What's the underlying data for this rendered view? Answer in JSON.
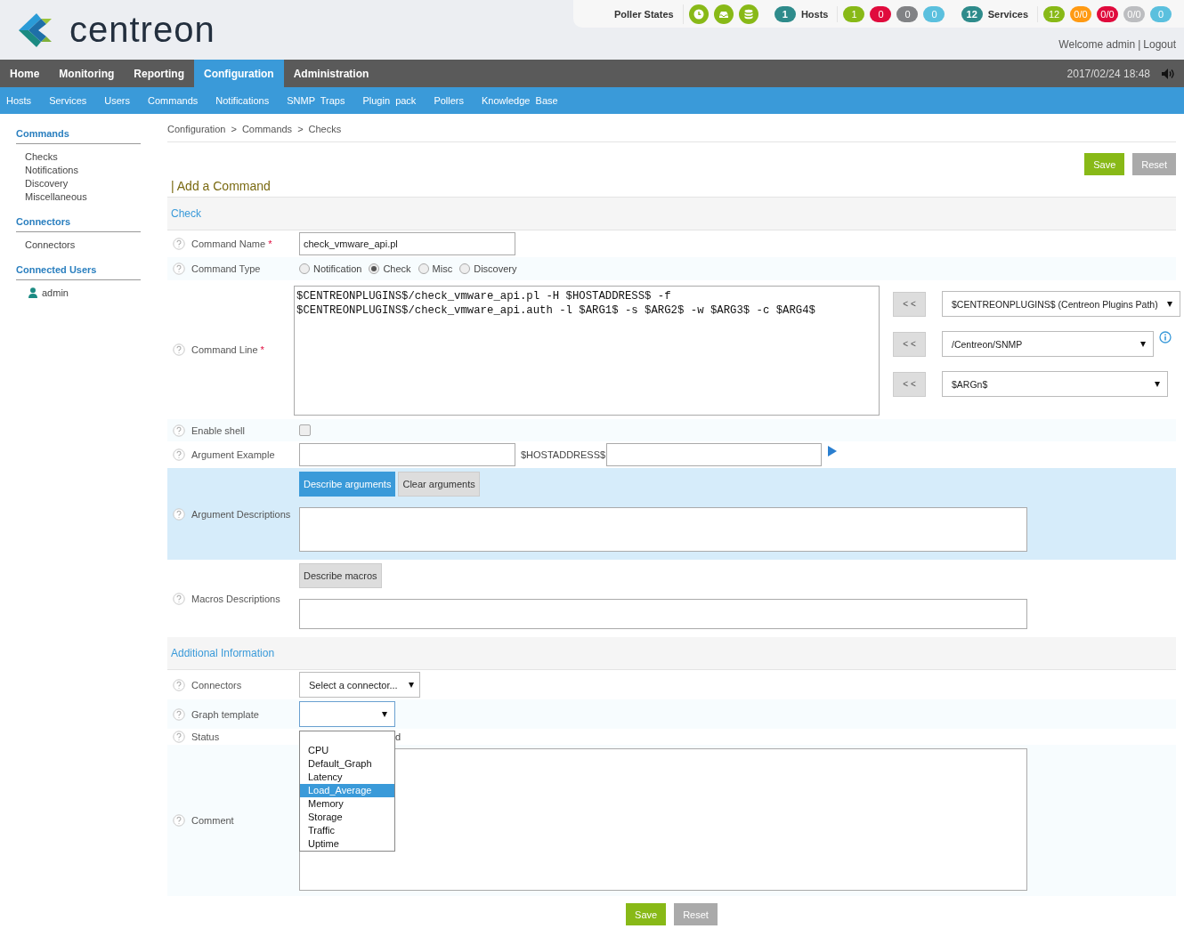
{
  "header": {
    "logo_text": "centreon",
    "poller_states": {
      "label": "Poller States"
    },
    "hosts": {
      "count": "1",
      "label": "Hosts",
      "badges": [
        {
          "text": "1",
          "color": "#88b917"
        },
        {
          "text": "0",
          "color": "#e00b3d"
        },
        {
          "text": "0",
          "color": "#818285"
        },
        {
          "text": "0",
          "color": "#5bc0de"
        }
      ]
    },
    "services": {
      "count": "12",
      "label": "Services",
      "badges": [
        {
          "text": "12",
          "color": "#88b917"
        },
        {
          "text": "0/0",
          "color": "#ff9a13"
        },
        {
          "text": "0/0",
          "color": "#e00b3d"
        },
        {
          "text": "0/0",
          "color": "#bcbdc0"
        },
        {
          "text": "0",
          "color": "#5bc0de"
        }
      ]
    },
    "welcome": "Welcome admin",
    "separator": "|",
    "logout": "Logout"
  },
  "menu": [
    {
      "label": "Home",
      "selected": false
    },
    {
      "label": "Monitoring",
      "selected": false
    },
    {
      "label": "Reporting",
      "selected": false
    },
    {
      "label": "Configuration",
      "selected": true
    },
    {
      "label": "Administration",
      "selected": false
    }
  ],
  "datetime": "2017/02/24 18:48",
  "submenu": [
    "Hosts",
    "Services",
    "Users",
    "Commands",
    "Notifications",
    "SNMP  Traps",
    "Plugin  pack",
    "Pollers",
    "Knowledge  Base"
  ],
  "sidebar": [
    {
      "title": "Commands",
      "kind": "links",
      "items": [
        "Checks",
        "Notifications",
        "Discovery",
        "Miscellaneous"
      ]
    },
    {
      "title": "Connectors",
      "kind": "links",
      "items": [
        "Connectors"
      ]
    },
    {
      "title": "Connected Users",
      "kind": "users",
      "items": [
        "admin"
      ]
    }
  ],
  "breadcrumb": {
    "items": [
      "Configuration",
      "Commands",
      "Checks"
    ],
    "separator": ">"
  },
  "top_buttons": [
    "Save",
    "Reset"
  ],
  "title": "| Add a Command",
  "sections": [
    {
      "title": "Check",
      "rows": [
        {
          "kind": "text",
          "label": "Command Name",
          "required_mark": "*",
          "value": "check_vmware_api.pl"
        },
        {
          "kind": "radio",
          "label": "Command Type",
          "options": [
            {
              "label": "Notification",
              "selected": false
            },
            {
              "label": "Check",
              "selected": true
            },
            {
              "label": "Misc",
              "selected": false
            },
            {
              "label": "Discovery",
              "selected": false
            }
          ]
        },
        {
          "kind": "command_line",
          "label": "Command Line",
          "required_mark": "*",
          "lines": [
            "$CENTREONPLUGINS$/check_vmware_api.pl -H $HOSTADDRESS$ -f",
            "$CENTREONPLUGINS$/check_vmware_api.auth -l $ARG1$ -s $ARG2$ -w $ARG3$ -c $ARG4$"
          ],
          "helpers": [
            {
              "button": "< <",
              "value": "$CENTREONPLUGINS$ (Centreon Plugins Path)",
              "info": false
            },
            {
              "button": "< <",
              "value": "/Centreon/SNMP",
              "info": true
            },
            {
              "button": "< <",
              "value": "$ARGn$",
              "info": false
            }
          ]
        },
        {
          "kind": "checkbox",
          "label": "Enable shell",
          "checked": false
        },
        {
          "kind": "argument_example",
          "label": "Argument Example",
          "macro": "$HOSTADDRESS$"
        },
        {
          "kind": "describe",
          "label": "Argument Descriptions",
          "highlighted": true,
          "buttons": [
            {
              "label": "Describe arguments",
              "primary": true
            },
            {
              "label": "Clear arguments",
              "primary": false
            }
          ]
        },
        {
          "kind": "describe",
          "label": "Macros Descriptions",
          "highlighted": false,
          "buttons": [
            {
              "label": "Describe macros",
              "primary": false
            }
          ]
        }
      ]
    },
    {
      "title": "Additional Information",
      "rows": [
        {
          "kind": "select",
          "label": "Connectors",
          "value": "Select a connector..."
        },
        {
          "kind": "dropdown",
          "label": "Graph template",
          "expanded": true,
          "options": [
            {
              "label": "CPU",
              "selected": false
            },
            {
              "label": "Default_Graph",
              "selected": false
            },
            {
              "label": "Latency",
              "selected": false
            },
            {
              "label": "Load_Average",
              "selected": true
            },
            {
              "label": "Memory",
              "selected": false
            },
            {
              "label": "Storage",
              "selected": false
            },
            {
              "label": "Traffic",
              "selected": false
            },
            {
              "label": "Uptime",
              "selected": false
            }
          ]
        },
        {
          "kind": "status",
          "label": "Status",
          "value": "d"
        },
        {
          "kind": "comment",
          "label": "Comment"
        }
      ]
    }
  ],
  "bottom_buttons": [
    "Save",
    "Reset"
  ]
}
